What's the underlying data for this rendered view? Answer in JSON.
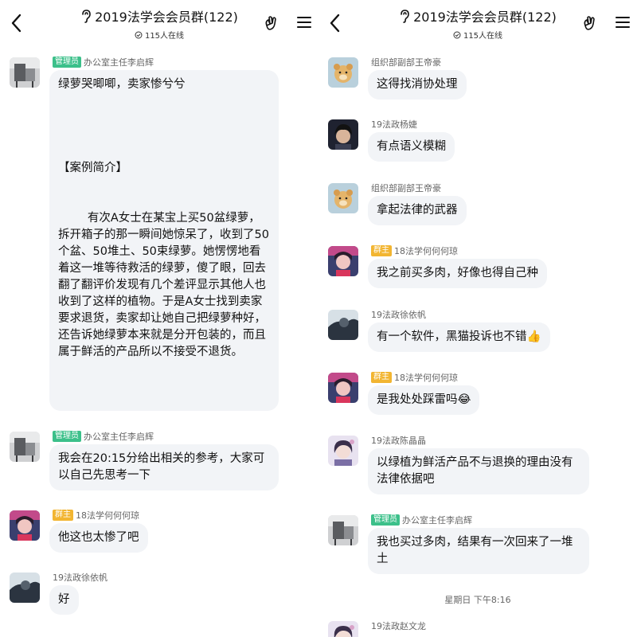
{
  "left": {
    "header": {
      "title": "2019法学会会员群(122)",
      "online": "115人在线"
    },
    "messages": [
      {
        "avatar": "avatar-chair",
        "badge": "管理员",
        "badge_type": "admin",
        "sender": "办公室主任李启辉",
        "text": "绿萝哭唧唧，卖家惨兮兮\n\n\n\n\n【案例简介】\n\n\n        有次A女士在某宝上买50盆绿萝，拆开箱子的那一瞬间她惊呆了，收到了50个盆、50堆土、50束绿萝。她愣愣地看着这一堆等待救活的绿萝，傻了眼，回去翻了翻评价发现有几个差评显示其他人也收到了这样的植物。于是A女士找到卖家要求退货，卖家却让她自己把绿萝种好，还告诉她绿萝本来就是分开包装的，而且属于鲜活的产品所以不接受不退货。"
      },
      {
        "avatar": "avatar-chair",
        "badge": "管理员",
        "badge_type": "admin",
        "sender": "办公室主任李启辉",
        "text": "我会在20:15分给出相关的参考，大家可以自己先思考一下"
      },
      {
        "avatar": "avatar-pink",
        "badge": "群主",
        "badge_type": "owner",
        "sender": "18法学何何何琼",
        "text": "他这也太惨了吧"
      },
      {
        "avatar": "avatar-dark",
        "badge": "",
        "badge_type": "",
        "sender": "19法政徐依帆",
        "text": "好"
      }
    ]
  },
  "right": {
    "header": {
      "title": "2019法学会会员群(122)",
      "online": "115人在线"
    },
    "messages": [
      {
        "avatar": "avatar-bear",
        "badge": "",
        "badge_type": "",
        "sender": "组织部副部王帝豪",
        "text": "这得找消协处理"
      },
      {
        "avatar": "avatar-boy",
        "badge": "",
        "badge_type": "",
        "sender": "19法政杨婕",
        "text": "有点语义模糊"
      },
      {
        "avatar": "avatar-bear",
        "badge": "",
        "badge_type": "",
        "sender": "组织部副部王帝豪",
        "text": "拿起法律的武器"
      },
      {
        "avatar": "avatar-pink",
        "badge": "群主",
        "badge_type": "owner",
        "sender": "18法学何何何琼",
        "text": "我之前买多肉，好像也得自己种"
      },
      {
        "avatar": "avatar-dark",
        "badge": "",
        "badge_type": "",
        "sender": "19法政徐依帆",
        "text": "有一个软件，黑猫投诉也不错👍"
      },
      {
        "avatar": "avatar-pink",
        "badge": "群主",
        "badge_type": "owner",
        "sender": "18法学何何何琼",
        "text": "是我处处踩雷吗😂"
      },
      {
        "avatar": "avatar-anime",
        "badge": "",
        "badge_type": "",
        "sender": "19法政陈晶晶",
        "text": "以绿植为鲜活产品不与退换的理由没有法律依据吧"
      },
      {
        "avatar": "avatar-chair",
        "badge": "管理员",
        "badge_type": "admin",
        "sender": "办公室主任李启辉",
        "text": "我也买过多肉，结果有一次回来了一堆土"
      }
    ],
    "timestamp": "星期日 下午8:16",
    "last_sender": "19法政赵文龙"
  }
}
